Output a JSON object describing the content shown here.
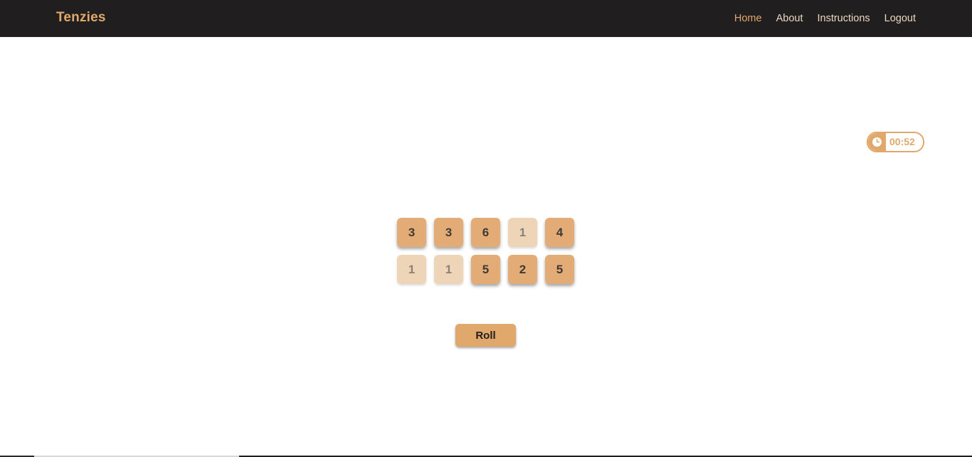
{
  "navbar": {
    "brand": "Tenzies",
    "links": [
      {
        "label": "Home",
        "active": true
      },
      {
        "label": "About",
        "active": false
      },
      {
        "label": "Instructions",
        "active": false
      },
      {
        "label": "Logout",
        "active": false
      }
    ]
  },
  "timer": {
    "icon": "clock-icon",
    "value": "00:52"
  },
  "dice": [
    {
      "value": "3",
      "held": false
    },
    {
      "value": "3",
      "held": false
    },
    {
      "value": "6",
      "held": false
    },
    {
      "value": "1",
      "held": true
    },
    {
      "value": "4",
      "held": false
    },
    {
      "value": "1",
      "held": true
    },
    {
      "value": "1",
      "held": true
    },
    {
      "value": "5",
      "held": false
    },
    {
      "value": "2",
      "held": false
    },
    {
      "value": "5",
      "held": false
    }
  ],
  "controls": {
    "roll_label": "Roll"
  },
  "colors": {
    "navbar_bg": "#201e1f",
    "accent": "#e0a86b",
    "die": "#e3ac77",
    "die_held": "#efd5b8"
  }
}
